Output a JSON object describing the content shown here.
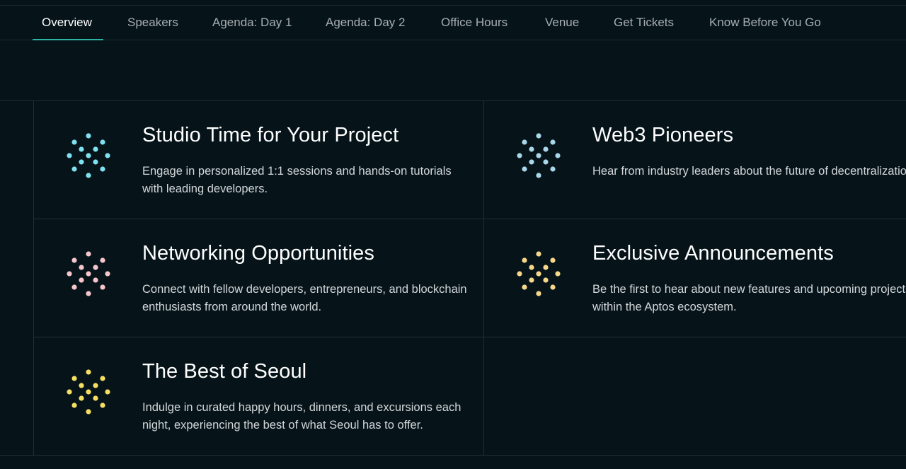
{
  "nav": {
    "tabs": [
      {
        "label": "Overview",
        "active": true
      },
      {
        "label": "Speakers",
        "active": false
      },
      {
        "label": "Agenda: Day 1",
        "active": false
      },
      {
        "label": "Agenda: Day 2",
        "active": false
      },
      {
        "label": "Office Hours",
        "active": false
      },
      {
        "label": "Venue",
        "active": false
      },
      {
        "label": "Get Tickets",
        "active": false
      },
      {
        "label": "Know Before You Go",
        "active": false
      }
    ],
    "accent_color": "#2bb3a3"
  },
  "features": [
    {
      "icon": "dot-pattern-icon",
      "color": "#7fe0f0",
      "title": "Studio Time for Your Project",
      "description": "Engage in personalized 1:1 sessions and hands-on tutorials with leading developers."
    },
    {
      "icon": "dot-pattern-icon",
      "color": "#a9d6e8",
      "title": "Web3 Pioneers",
      "description": "Hear from industry leaders about the future of decentralization."
    },
    {
      "icon": "dot-pattern-icon",
      "color": "#f6c6cc",
      "title": "Networking Opportunities",
      "description": "Connect with fellow developers, entrepreneurs, and blockchain enthusiasts from around the world."
    },
    {
      "icon": "dot-pattern-icon",
      "color": "#f7d88a",
      "title": "Exclusive Announcements",
      "description": "Be the first to hear about new features and upcoming projects within the Aptos ecosystem."
    },
    {
      "icon": "dot-pattern-icon",
      "color": "#f5df62",
      "title": "The Best of Seoul",
      "description": "Indulge in curated happy hours, dinners, and excursions each night, experiencing the best of what Seoul has to offer."
    }
  ]
}
